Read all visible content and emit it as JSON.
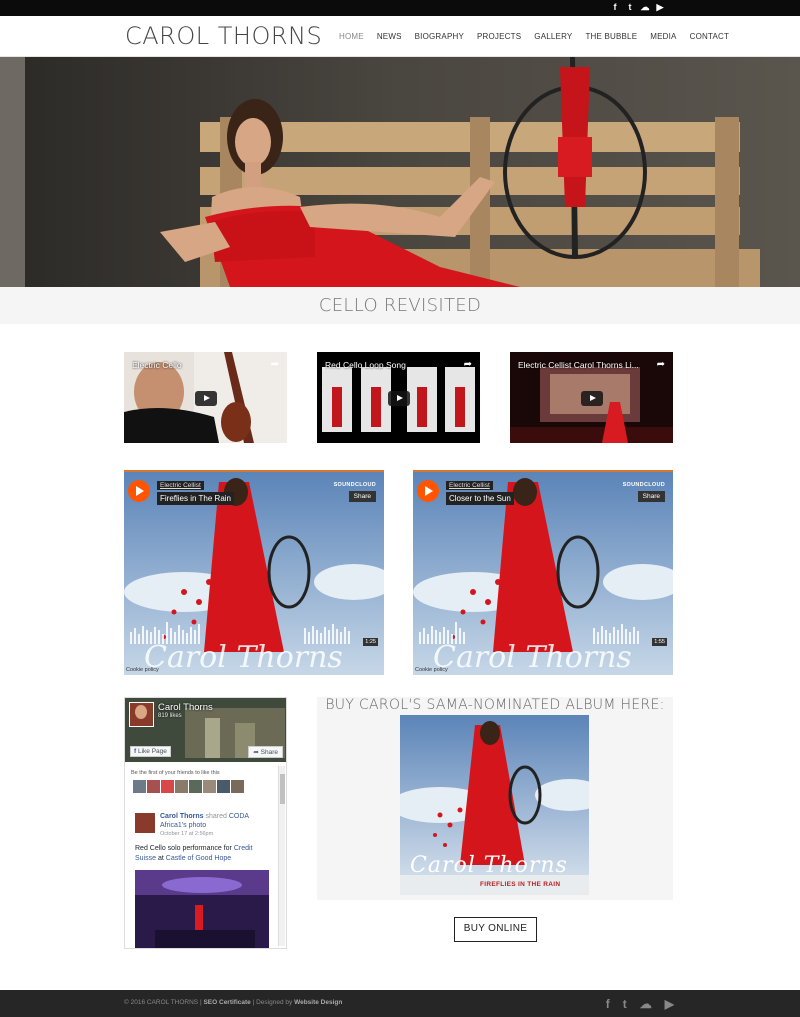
{
  "topbar": {
    "social": [
      {
        "icon": "facebook-icon",
        "glyph": "f"
      },
      {
        "icon": "twitter-icon",
        "glyph": "t"
      },
      {
        "icon": "soundcloud-icon",
        "glyph": "☁"
      },
      {
        "icon": "youtube-icon",
        "glyph": "▶"
      }
    ]
  },
  "header": {
    "logo": "CAROL THORNS",
    "nav": [
      "HOME",
      "NEWS",
      "BIOGRAPHY",
      "PROJECTS",
      "GALLERY",
      "THE BUBBLE",
      "MEDIA",
      "CONTACT"
    ],
    "active_nav": "HOME"
  },
  "section": {
    "title": "CELLO REVISITED"
  },
  "videos": [
    {
      "title": "Electric Cello"
    },
    {
      "title": "Red Cello Loop Song"
    },
    {
      "title": "Electric Cellist Carol Thorns Li..."
    }
  ],
  "soundcloud": [
    {
      "artist": "Electric Cellist",
      "track": "Fireflies in The Rain",
      "duration": "1:25",
      "logo": "SOUNDCLOUD",
      "share": "Share",
      "cookie": "Cookie policy"
    },
    {
      "artist": "Electric Cellist",
      "track": "Closer to the Sun",
      "duration": "1:55",
      "logo": "SOUNDCLOUD",
      "share": "Share",
      "cookie": "Cookie policy"
    }
  ],
  "facebook": {
    "page_name": "Carol Thorns",
    "likes": "819 likes",
    "like_button": "Like Page",
    "share_button": "Share",
    "friends_text": "Be the first of your friends to like this",
    "post": {
      "author": "Carol Thorns",
      "shared_text": "shared",
      "shared_source": "CODA",
      "photo_link": "Africa1's photo",
      "time": "October 17 at 2:56pm",
      "text_prefix": "Red Cello solo performance for",
      "link1": "Credit Suisse",
      "text_mid": "at",
      "link2": "Castle of Good Hope"
    }
  },
  "album": {
    "heading": "BUY CAROL'S SAMA-NOMINATED ALBUM HERE:",
    "cover_signature": "Carol Thorns",
    "cover_title": "FIREFLIES IN THE RAIN"
  },
  "buy_button": "BUY ONLINE",
  "footer": {
    "copyright": "© 2016 CAROL THORNS |",
    "seo": "SEO Certificate",
    "designed": "| Designed by",
    "design_link": "Website Design",
    "social": [
      {
        "icon": "facebook-icon",
        "glyph": "f"
      },
      {
        "icon": "twitter-icon",
        "glyph": "t"
      },
      {
        "icon": "soundcloud-icon",
        "glyph": "☁"
      },
      {
        "icon": "youtube-icon",
        "glyph": "▶"
      }
    ]
  },
  "colors": {
    "accent_red": "#d4161c",
    "soundcloud_orange": "#ff5500",
    "facebook_blue": "#365899",
    "footer_bg": "#262626"
  }
}
